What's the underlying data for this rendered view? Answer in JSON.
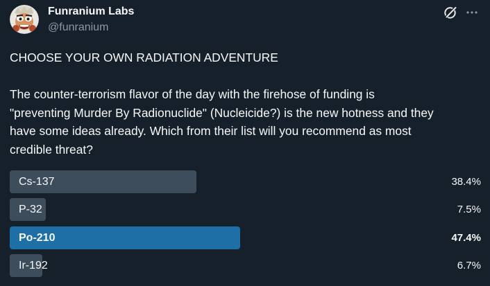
{
  "author": {
    "display_name": "Funranium Labs",
    "handle": "@funranium",
    "avatar_icon": "cartoon-character-avatar"
  },
  "header_icons": {
    "grok": "grok-icon",
    "more": "more-options-icon"
  },
  "tweet": {
    "title": "CHOOSE YOUR OWN RADIATION ADVENTURE",
    "body_lines": [
      "The counter-terrorism flavor of the day with the firehose of funding is",
      "\"preventing Murder By Radionuclide\" (Nucleicide?) is the new hotness and they",
      "have some ideas already. Which from their list will you recommend as most",
      "credible threat?"
    ]
  },
  "poll": {
    "options": [
      {
        "label": "Cs-137",
        "percent_text": "38.4%",
        "percent": 38.4,
        "winner": false
      },
      {
        "label": "P-32",
        "percent_text": "7.5%",
        "percent": 7.5,
        "winner": false
      },
      {
        "label": "Po-210",
        "percent_text": "47.4%",
        "percent": 47.4,
        "winner": true
      },
      {
        "label": "Ir-192",
        "percent_text": "6.7%",
        "percent": 6.7,
        "winner": false
      }
    ]
  },
  "colors": {
    "background": "#15202b",
    "bar": "#3e4d5c",
    "winner_bar": "#1d6fa5",
    "secondary_text": "#8b98a5"
  }
}
